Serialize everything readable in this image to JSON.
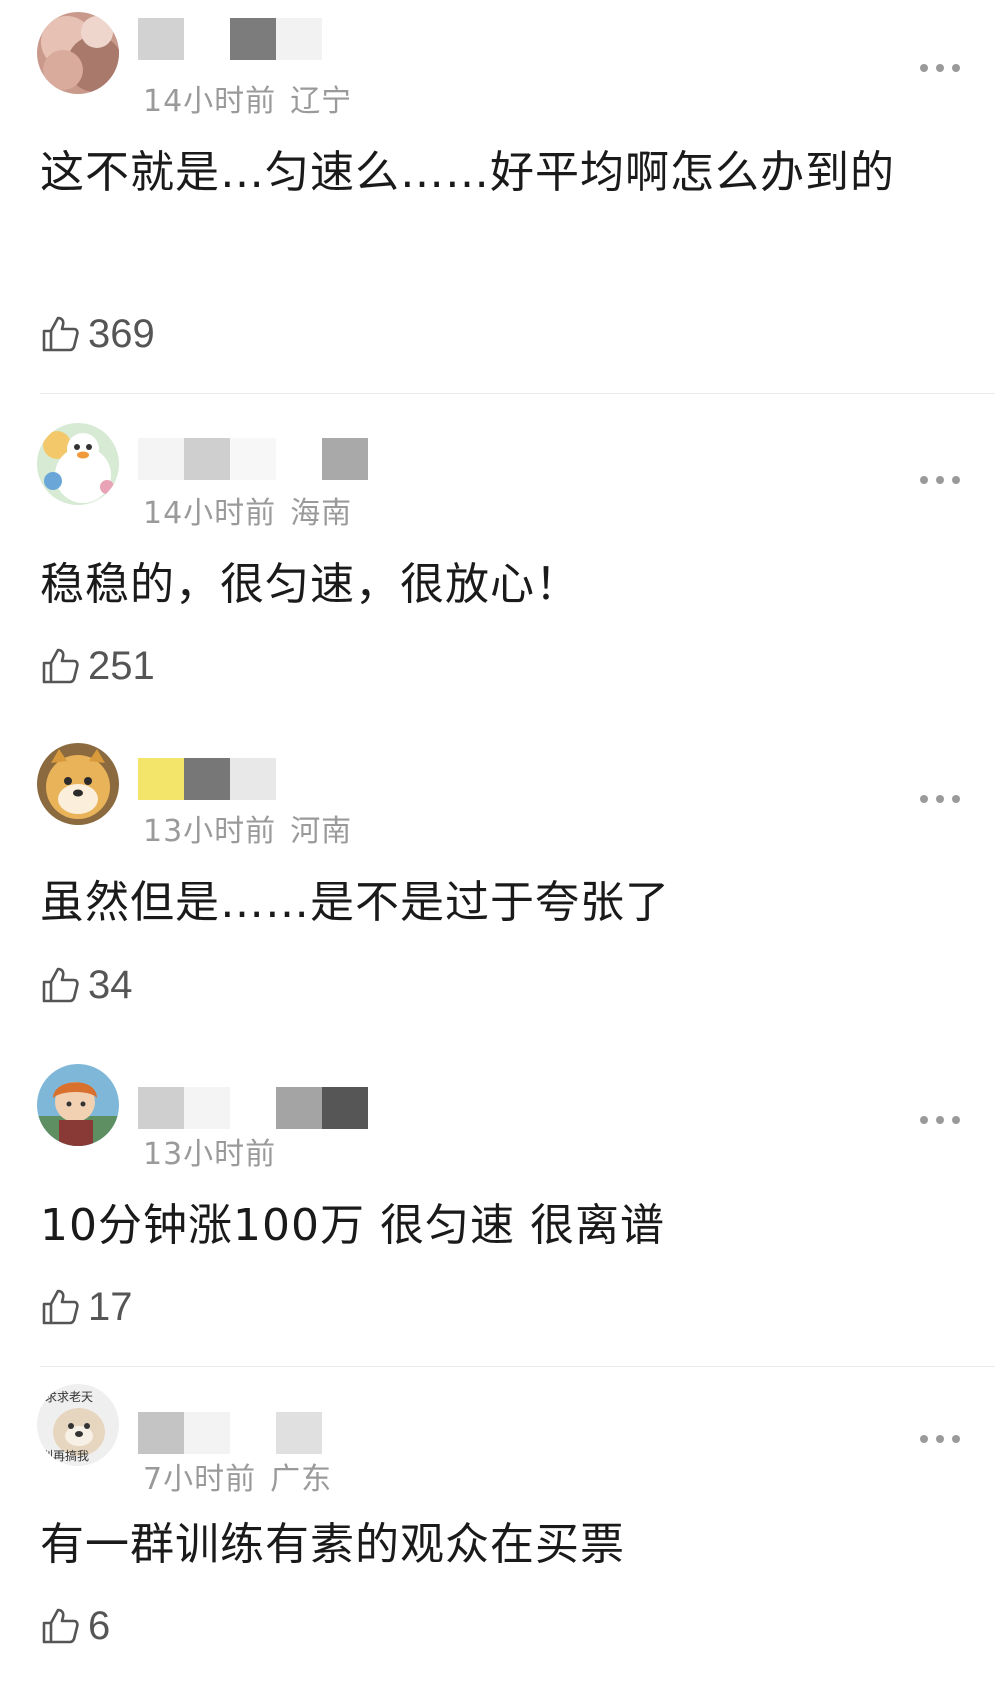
{
  "comments": [
    {
      "time": "14小时前",
      "location": "辽宁",
      "text": "这不就是…匀速么……好平均啊怎么办到的",
      "likes": "369",
      "avatar": "blurred-photo-avatar",
      "name_colors": [
        "#d2d2d2",
        "#7c7c7c",
        "#f2f2f2"
      ]
    },
    {
      "time": "14小时前",
      "location": "海南",
      "text": "稳稳的，很匀速，很放心！",
      "likes": "251",
      "avatar": "cartoon-duck-avatar",
      "name_colors": [
        "#f4f4f4",
        "#cfcfcf",
        "#f7f7f7",
        "#a9a9a9"
      ]
    },
    {
      "time": "13小时前",
      "location": "河南",
      "text": "虽然但是……是不是过于夸张了",
      "likes": "34",
      "avatar": "doge-avatar",
      "name_colors": [
        "#777777",
        "#e8e8e8"
      ]
    },
    {
      "time": "13小时前",
      "location": "",
      "text": "10分钟涨100万 很匀速 很离谱",
      "likes": "17",
      "avatar": "anime-boy-avatar",
      "name_colors": [
        "#cfcfcf",
        "#f4f4f4",
        "#a4a4a4",
        "#565656"
      ]
    },
    {
      "time": "7小时前",
      "location": "广东",
      "text": "有一群训练有素的观众在买票",
      "likes": "6",
      "avatar": "dog-meme-avatar",
      "avatar_text_top": "求求老天",
      "avatar_text_bottom": "别再搞我",
      "name_colors": [
        "#c4c4c4",
        "#f3f3f3",
        "#e0e0e0"
      ]
    }
  ],
  "icons": {
    "like": "thumbs-up-icon",
    "more": "more-dots-icon"
  },
  "colors": {
    "meta_text": "#9a9a9a",
    "body_text": "#1a1a1a",
    "divider": "#ebebeb"
  }
}
